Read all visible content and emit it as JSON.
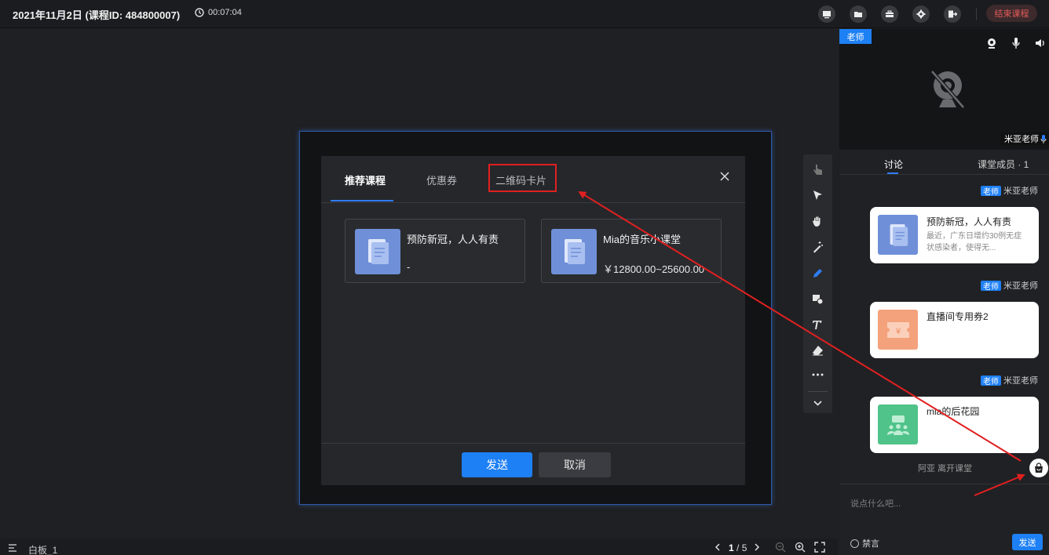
{
  "header": {
    "course_title": "2021年11月2日 (课程ID: 484800007)",
    "timer": "00:07:04",
    "end_class_label": "结束课程",
    "icons": [
      "screen-share-icon",
      "folder-icon",
      "toolbox-icon",
      "gear-icon",
      "exit-icon"
    ]
  },
  "dialog": {
    "tabs": [
      {
        "label": "推荐课程",
        "active": true
      },
      {
        "label": "优惠券",
        "active": false
      },
      {
        "label": "二维码卡片",
        "active": false
      }
    ],
    "cards": [
      {
        "title": "预防新冠，人人有责",
        "subtitle": "-"
      },
      {
        "title": "Mia的音乐小课堂",
        "subtitle": "￥12800.00~25600.00"
      }
    ],
    "send_label": "发送",
    "cancel_label": "取消"
  },
  "tools": [
    "pointer-hand-icon",
    "arrow-cursor-icon",
    "grab-hand-icon",
    "magic-wand-icon",
    "pen-icon",
    "shapes-icon",
    "text-icon",
    "eraser-icon",
    "more-icon",
    "collapse-icon"
  ],
  "bottom": {
    "board_name": "白板_1",
    "current_page": "1",
    "total_pages": "5"
  },
  "right_panel": {
    "teacher_tag": "老师",
    "video_name": "米亚老师",
    "tabs": [
      {
        "label": "讨论",
        "active": true
      },
      {
        "label": "课堂成员 · 1",
        "active": false
      }
    ],
    "messages": [
      {
        "role": "老师",
        "sender": "米亚老师",
        "title": "预防新冠，人人有责",
        "desc": "最近，广东日增约30例无症状感染者，使得无...",
        "thumb_color": "#6f90d8",
        "type": "course"
      },
      {
        "role": "老师",
        "sender": "米亚老师",
        "title": "直播间专用券2",
        "desc": "",
        "thumb_color": "#f4a27c",
        "type": "coupon"
      },
      {
        "role": "老师",
        "sender": "米亚老师",
        "title": "mia的后花园",
        "desc": "",
        "thumb_color": "#4fc38a",
        "type": "qrcode"
      }
    ],
    "leave_note": "阿亚 离开课堂",
    "input_placeholder": "说点什么吧...",
    "mute_label": "禁言",
    "send_label": "发送"
  },
  "colors": {
    "accent": "#1e80f5",
    "highlight": "#e02020",
    "end_button": "#e35b5b"
  }
}
